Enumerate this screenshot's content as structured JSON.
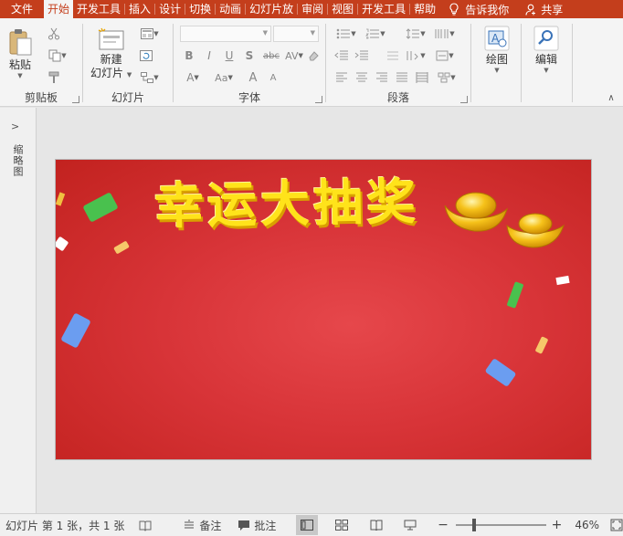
{
  "tabs": [
    "文件",
    "开始",
    "开发工具",
    "插入",
    "设计",
    "切换",
    "动画",
    "幻灯片放",
    "审阅",
    "视图",
    "开发工具",
    "帮助"
  ],
  "active_tab_index": 1,
  "tellme": "告诉我你",
  "share": "共享",
  "ribbon": {
    "clipboard": {
      "paste": "粘贴",
      "group": "剪贴板"
    },
    "slides": {
      "new_slide_1": "新建",
      "new_slide_2": "幻灯片",
      "group": "幻灯片"
    },
    "font": {
      "group": "字体"
    },
    "paragraph": {
      "group": "段落"
    },
    "drawing": {
      "label": "绘图"
    },
    "editing": {
      "label": "编辑"
    }
  },
  "left_panel": {
    "label": "缩略图"
  },
  "slide": {
    "title": "幸运大抽奖"
  },
  "status": {
    "slide_info": "幻灯片 第 1 张，共 1 张",
    "notes": "备注",
    "comments": "批注",
    "zoom_percent": 46,
    "zoom_label": "46%"
  },
  "colors": {
    "accent": "#c43e1c",
    "slide_red": "#d83438",
    "title_yellow": "#ffe31a"
  }
}
